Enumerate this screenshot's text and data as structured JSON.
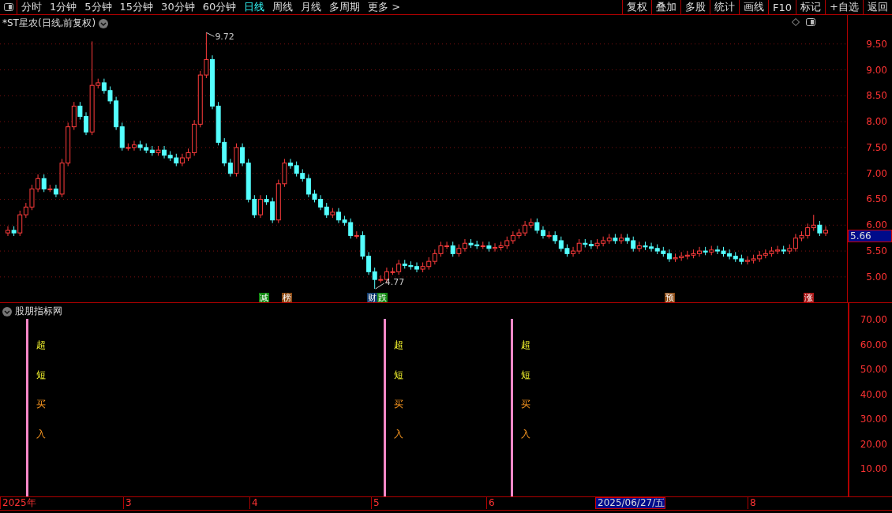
{
  "toolbar": {
    "periods": [
      {
        "label": "分时",
        "selected": false
      },
      {
        "label": "1分钟",
        "selected": false
      },
      {
        "label": "5分钟",
        "selected": false
      },
      {
        "label": "15分钟",
        "selected": false
      },
      {
        "label": "30分钟",
        "selected": false
      },
      {
        "label": "60分钟",
        "selected": false
      },
      {
        "label": "日线",
        "selected": true
      },
      {
        "label": "周线",
        "selected": false
      },
      {
        "label": "月线",
        "selected": false
      },
      {
        "label": "多周期",
        "selected": false
      },
      {
        "label": "更多 >",
        "selected": false
      }
    ],
    "buttons": [
      "复权",
      "叠加",
      "多股",
      "统计",
      "画线",
      "F10",
      "标记",
      "+自选",
      "返回"
    ]
  },
  "price_chart": {
    "title": "*ST星农(日线,前复权)",
    "current_price": "5.66",
    "high_label": "9.72",
    "low_label": "4.77",
    "chart_data": {
      "type": "candlestick",
      "grid": true,
      "ylim": [
        4.51,
        10.06
      ],
      "yticks": [
        {
          "value": 9.5,
          "label": "9.50"
        },
        {
          "value": 9,
          "label": "9.00"
        },
        {
          "value": 8.5,
          "label": "8.50"
        },
        {
          "value": 8,
          "label": "8.00"
        },
        {
          "value": 7.5,
          "label": "7.50"
        },
        {
          "value": 7,
          "label": "7.00"
        },
        {
          "value": 6.5,
          "label": "6.50"
        },
        {
          "value": 6,
          "label": "6.00"
        },
        {
          "value": 5.5,
          "label": "5.50"
        },
        {
          "value": 5,
          "label": "5.00"
        }
      ],
      "ohlc": [
        [
          5.85,
          5.98,
          5.79,
          5.9
        ],
        [
          5.9,
          5.98,
          5.79,
          5.85
        ],
        [
          5.85,
          6.28,
          5.79,
          6.2
        ],
        [
          6.2,
          6.43,
          6.14,
          6.35
        ],
        [
          6.35,
          6.78,
          6.29,
          6.7
        ],
        [
          6.7,
          6.98,
          6.64,
          6.9
        ],
        [
          6.9,
          6.98,
          6.64,
          6.7
        ],
        [
          6.7,
          6.78,
          6.64,
          6.7
        ],
        [
          6.7,
          6.78,
          6.54,
          6.6
        ],
        [
          6.6,
          7.28,
          6.54,
          7.2
        ],
        [
          7.2,
          7.98,
          7.14,
          7.9
        ],
        [
          7.9,
          8.38,
          7.84,
          8.3
        ],
        [
          8.3,
          8.38,
          8.04,
          8.1
        ],
        [
          8.1,
          8.18,
          7.74,
          7.8
        ],
        [
          7.8,
          9.55,
          7.74,
          8.7
        ],
        [
          8.7,
          8.83,
          8.64,
          8.75
        ],
        [
          8.75,
          8.83,
          8.54,
          8.6
        ],
        [
          8.6,
          8.68,
          8.34,
          8.4
        ],
        [
          8.4,
          8.48,
          7.84,
          7.9
        ],
        [
          7.9,
          7.98,
          7.44,
          7.5
        ],
        [
          7.5,
          7.58,
          7.44,
          7.5
        ],
        [
          7.5,
          7.63,
          7.44,
          7.55
        ],
        [
          7.55,
          7.63,
          7.44,
          7.5
        ],
        [
          7.5,
          7.58,
          7.39,
          7.45
        ],
        [
          7.45,
          7.53,
          7.34,
          7.4
        ],
        [
          7.4,
          7.53,
          7.34,
          7.45
        ],
        [
          7.45,
          7.53,
          7.29,
          7.35
        ],
        [
          7.35,
          7.43,
          7.24,
          7.3
        ],
        [
          7.3,
          7.38,
          7.14,
          7.2
        ],
        [
          7.2,
          7.38,
          7.14,
          7.3
        ],
        [
          7.3,
          7.48,
          7.24,
          7.4
        ],
        [
          7.4,
          8.03,
          7.34,
          7.95
        ],
        [
          7.95,
          8.98,
          7.89,
          8.9
        ],
        [
          8.9,
          9.72,
          8.84,
          9.2
        ],
        [
          9.2,
          9.28,
          8.24,
          8.3
        ],
        [
          8.3,
          8.38,
          7.54,
          7.6
        ],
        [
          7.6,
          7.68,
          7.14,
          7.2
        ],
        [
          7.2,
          7.28,
          6.94,
          7.0
        ],
        [
          7.0,
          7.58,
          6.94,
          7.5
        ],
        [
          7.5,
          7.58,
          7.14,
          7.2
        ],
        [
          7.2,
          7.28,
          6.44,
          6.5
        ],
        [
          6.5,
          6.58,
          6.14,
          6.2
        ],
        [
          6.2,
          6.58,
          6.14,
          6.5
        ],
        [
          6.5,
          6.58,
          6.39,
          6.45
        ],
        [
          6.45,
          6.53,
          6.04,
          6.1
        ],
        [
          6.1,
          6.88,
          6.04,
          6.8
        ],
        [
          6.8,
          7.28,
          6.74,
          7.2
        ],
        [
          7.2,
          7.28,
          7.09,
          7.15
        ],
        [
          7.15,
          7.23,
          6.94,
          7.0
        ],
        [
          7.0,
          7.08,
          6.84,
          6.9
        ],
        [
          6.9,
          6.98,
          6.54,
          6.6
        ],
        [
          6.6,
          6.68,
          6.44,
          6.5
        ],
        [
          6.5,
          6.58,
          6.29,
          6.35
        ],
        [
          6.35,
          6.43,
          6.14,
          6.2
        ],
        [
          6.2,
          6.33,
          6.14,
          6.25
        ],
        [
          6.25,
          6.33,
          6.04,
          6.1
        ],
        [
          6.1,
          6.18,
          5.99,
          6.05
        ],
        [
          6.05,
          6.13,
          5.74,
          5.8
        ],
        [
          5.8,
          5.88,
          5.74,
          5.8
        ],
        [
          5.8,
          5.88,
          5.34,
          5.4
        ],
        [
          5.4,
          5.48,
          5.04,
          5.1
        ],
        [
          5.1,
          5.18,
          4.77,
          4.95
        ],
        [
          4.95,
          5.03,
          4.89,
          4.95
        ],
        [
          4.95,
          5.18,
          4.89,
          5.1
        ],
        [
          5.1,
          5.18,
          5.04,
          5.1
        ],
        [
          5.1,
          5.33,
          5.04,
          5.25
        ],
        [
          5.25,
          5.33,
          5.16,
          5.22
        ],
        [
          5.22,
          5.3,
          5.14,
          5.2
        ],
        [
          5.2,
          5.28,
          5.09,
          5.15
        ],
        [
          5.15,
          5.28,
          5.09,
          5.2
        ],
        [
          5.2,
          5.38,
          5.14,
          5.3
        ],
        [
          5.3,
          5.53,
          5.24,
          5.45
        ],
        [
          5.45,
          5.68,
          5.39,
          5.6
        ],
        [
          5.6,
          5.68,
          5.54,
          5.6
        ],
        [
          5.6,
          5.68,
          5.39,
          5.45
        ],
        [
          5.45,
          5.63,
          5.39,
          5.55
        ],
        [
          5.55,
          5.73,
          5.49,
          5.65
        ],
        [
          5.65,
          5.73,
          5.56,
          5.62
        ],
        [
          5.62,
          5.7,
          5.54,
          5.6
        ],
        [
          5.6,
          5.68,
          5.54,
          5.6
        ],
        [
          5.6,
          5.68,
          5.49,
          5.55
        ],
        [
          5.55,
          5.65,
          5.49,
          5.57
        ],
        [
          5.57,
          5.68,
          5.51,
          5.6
        ],
        [
          5.6,
          5.78,
          5.54,
          5.7
        ],
        [
          5.7,
          5.88,
          5.64,
          5.8
        ],
        [
          5.8,
          5.93,
          5.74,
          5.85
        ],
        [
          5.85,
          6.08,
          5.79,
          6.0
        ],
        [
          6.0,
          6.13,
          5.94,
          6.05
        ],
        [
          6.05,
          6.13,
          5.84,
          5.9
        ],
        [
          5.9,
          5.98,
          5.74,
          5.8
        ],
        [
          5.8,
          5.88,
          5.74,
          5.8
        ],
        [
          5.8,
          5.88,
          5.64,
          5.7
        ],
        [
          5.7,
          5.78,
          5.49,
          5.55
        ],
        [
          5.55,
          5.63,
          5.39,
          5.45
        ],
        [
          5.45,
          5.58,
          5.39,
          5.5
        ],
        [
          5.5,
          5.73,
          5.44,
          5.65
        ],
        [
          5.65,
          5.73,
          5.57,
          5.63
        ],
        [
          5.63,
          5.71,
          5.54,
          5.6
        ],
        [
          5.6,
          5.73,
          5.54,
          5.65
        ],
        [
          5.65,
          5.78,
          5.59,
          5.7
        ],
        [
          5.7,
          5.83,
          5.64,
          5.75
        ],
        [
          5.75,
          5.83,
          5.64,
          5.7
        ],
        [
          5.7,
          5.83,
          5.64,
          5.75
        ],
        [
          5.75,
          5.83,
          5.64,
          5.7
        ],
        [
          5.7,
          5.78,
          5.49,
          5.55
        ],
        [
          5.55,
          5.68,
          5.49,
          5.6
        ],
        [
          5.6,
          5.68,
          5.52,
          5.58
        ],
        [
          5.58,
          5.66,
          5.49,
          5.55
        ],
        [
          5.55,
          5.63,
          5.44,
          5.5
        ],
        [
          5.5,
          5.58,
          5.39,
          5.45
        ],
        [
          5.45,
          5.53,
          5.29,
          5.35
        ],
        [
          5.35,
          5.45,
          5.29,
          5.37
        ],
        [
          5.37,
          5.48,
          5.31,
          5.4
        ],
        [
          5.4,
          5.5,
          5.34,
          5.42
        ],
        [
          5.42,
          5.53,
          5.36,
          5.45
        ],
        [
          5.45,
          5.58,
          5.39,
          5.5
        ],
        [
          5.5,
          5.58,
          5.42,
          5.48
        ],
        [
          5.48,
          5.6,
          5.42,
          5.52
        ],
        [
          5.52,
          5.6,
          5.44,
          5.5
        ],
        [
          5.5,
          5.58,
          5.39,
          5.45
        ],
        [
          5.45,
          5.53,
          5.34,
          5.4
        ],
        [
          5.4,
          5.48,
          5.29,
          5.35
        ],
        [
          5.35,
          5.43,
          5.24,
          5.3
        ],
        [
          5.3,
          5.4,
          5.24,
          5.32
        ],
        [
          5.32,
          5.43,
          5.26,
          5.35
        ],
        [
          5.35,
          5.5,
          5.29,
          5.42
        ],
        [
          5.42,
          5.53,
          5.36,
          5.45
        ],
        [
          5.45,
          5.58,
          5.39,
          5.5
        ],
        [
          5.5,
          5.6,
          5.44,
          5.52
        ],
        [
          5.52,
          5.6,
          5.44,
          5.5
        ],
        [
          5.5,
          5.63,
          5.44,
          5.55
        ],
        [
          5.55,
          5.83,
          5.49,
          5.75
        ],
        [
          5.75,
          5.88,
          5.69,
          5.8
        ],
        [
          5.8,
          6.03,
          5.74,
          5.95
        ],
        [
          5.95,
          6.2,
          5.89,
          6.0
        ],
        [
          6.0,
          6.08,
          5.79,
          5.85
        ],
        [
          5.85,
          5.98,
          5.79,
          5.9
        ]
      ]
    },
    "markers": [
      {
        "text": "减",
        "color": "#118811"
      },
      {
        "text": "榜",
        "color": "#8b4a14"
      },
      {
        "text": "财",
        "color": "#123c6e"
      },
      {
        "text": "跌",
        "color": "#118811"
      },
      {
        "text": "预",
        "color": "#8b4a14"
      },
      {
        "text": "涨",
        "color": "#aa1818"
      }
    ]
  },
  "indicator": {
    "title": "股朋指标网",
    "axis_labels": [
      "70.00",
      "60.00",
      "50.00",
      "40.00",
      "30.00",
      "20.00",
      "10.00"
    ],
    "signals": [
      {
        "lines": [
          "超",
          "短",
          "买",
          "入"
        ]
      },
      {
        "lines": [
          "超",
          "短",
          "买",
          "入"
        ]
      },
      {
        "lines": [
          "超",
          "短",
          "买",
          "入"
        ]
      }
    ]
  },
  "date_axis": {
    "labels": [
      {
        "text": "2025年",
        "selected": false
      },
      {
        "text": "3",
        "selected": false
      },
      {
        "text": "4",
        "selected": false
      },
      {
        "text": "5",
        "selected": false
      },
      {
        "text": "6",
        "selected": false
      },
      {
        "text": "2025/06/27/五",
        "selected": true
      },
      {
        "text": "8",
        "selected": false
      }
    ]
  }
}
